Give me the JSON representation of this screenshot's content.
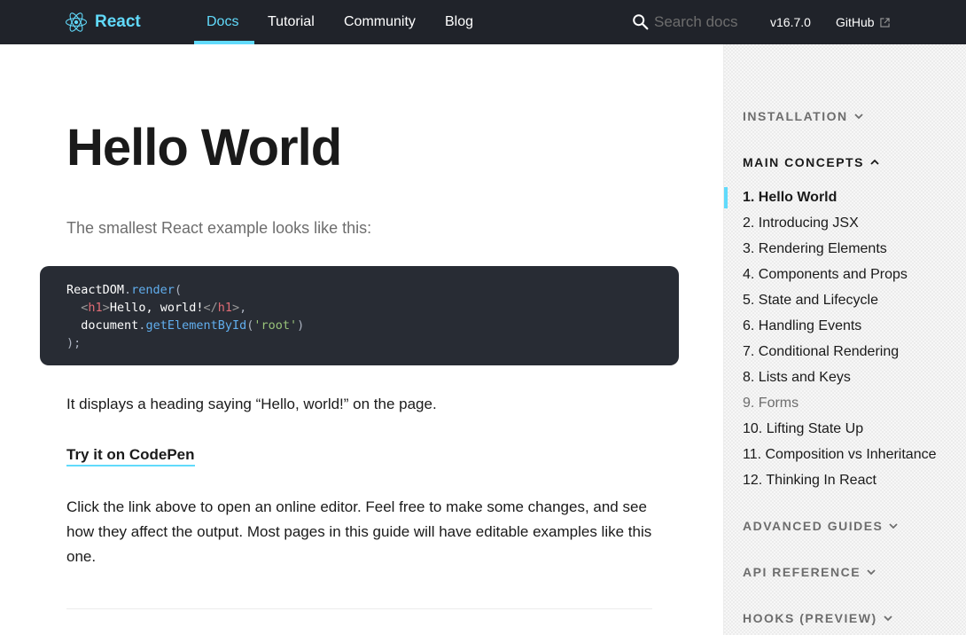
{
  "nav": {
    "brand": "React",
    "links": [
      "Docs",
      "Tutorial",
      "Community",
      "Blog"
    ],
    "search_placeholder": "Search docs",
    "version": "v16.7.0",
    "github": "GitHub"
  },
  "content": {
    "title": "Hello World",
    "intro": "The smallest React example looks like this:",
    "code": {
      "line1_obj": "ReactDOM",
      "line1_dot": ".",
      "line1_fn": "render",
      "line1_paren": "(",
      "line2_indent": "  ",
      "line2_lt": "<",
      "line2_tag": "h1",
      "line2_gt": ">",
      "line2_text": "Hello, world!",
      "line2_close_lt": "</",
      "line2_close_tag": "h1",
      "line2_close_gt": ">",
      "line2_comma": ",",
      "line3_indent": "  ",
      "line3_obj": "document",
      "line3_dot": ".",
      "line3_fn": "getElementById",
      "line3_open": "(",
      "line3_str": "'root'",
      "line3_close": ")",
      "line4": ");"
    },
    "paragraph1": "It displays a heading saying “Hello, world!” on the page.",
    "codepen_link": "Try it on CodePen",
    "paragraph2": "Click the link above to open an online editor. Feel free to make some changes, and see how they affect the output. Most pages in this guide will have editable examples like this one."
  },
  "sidebar": {
    "installation": "INSTALLATION",
    "main_concepts": "MAIN CONCEPTS",
    "items": [
      "1. Hello World",
      "2. Introducing JSX",
      "3. Rendering Elements",
      "4. Components and Props",
      "5. State and Lifecycle",
      "6. Handling Events",
      "7. Conditional Rendering",
      "8. Lists and Keys",
      "9. Forms",
      "10. Lifting State Up",
      "11. Composition vs Inheritance",
      "12. Thinking In React"
    ],
    "advanced_guides": "ADVANCED GUIDES",
    "api_reference": "API REFERENCE",
    "hooks": "HOOKS (PREVIEW)"
  },
  "colors": {
    "accent": "#61dafb",
    "nav_bg": "#20232a",
    "code_bg": "#282c34"
  }
}
